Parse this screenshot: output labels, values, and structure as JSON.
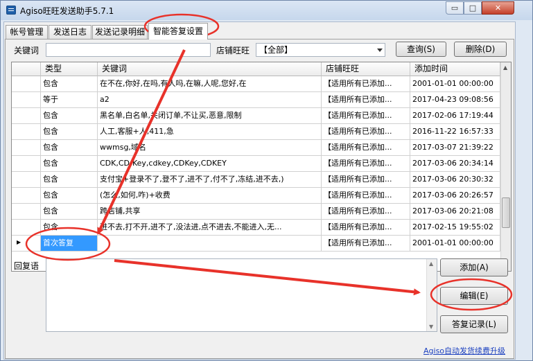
{
  "window": {
    "title": "Agiso旺旺发送助手5.7.1",
    "controls": {
      "minimize": "▭",
      "maximize": "□",
      "close": "✕"
    }
  },
  "tabs": [
    {
      "label": "帐号管理"
    },
    {
      "label": "发送日志"
    },
    {
      "label": "发送记录明细"
    },
    {
      "label": "智能答复设置"
    }
  ],
  "filter": {
    "keyword_label": "关键词",
    "keyword_value": "",
    "shop_label": "店铺旺旺",
    "shop_selected": "【全部】",
    "query_button": "查询(S)",
    "delete_button": "删除(D)"
  },
  "grid": {
    "columns": [
      "类型",
      "关键词",
      "店铺旺旺",
      "添加时间"
    ],
    "rows": [
      {
        "type": "包含",
        "keyword": "在不在,你好,在吗,有人吗,在嘛,人呢,您好,在",
        "shop": "【适用所有已添加...",
        "time": "2001-01-01 00:00:00"
      },
      {
        "type": "等于",
        "keyword": "a2",
        "shop": "【适用所有已添加...",
        "time": "2017-04-23 09:08:56"
      },
      {
        "type": "包含",
        "keyword": "黑名单,白名单,关闭订单,不让买,恶意,限制",
        "shop": "【适用所有已添加...",
        "time": "2017-02-06 17:19:44"
      },
      {
        "type": "包含",
        "keyword": "人工,客服+人,411,急",
        "shop": "【适用所有已添加...",
        "time": "2016-11-22 16:57:33"
      },
      {
        "type": "包含",
        "keyword": "wwmsg,域名",
        "shop": "【适用所有已添加...",
        "time": "2017-03-07 21:39:22"
      },
      {
        "type": "包含",
        "keyword": "CDK,CD-Key,cdkey,CDKey,CDKEY",
        "shop": "【适用所有已添加...",
        "time": "2017-03-06 20:34:14"
      },
      {
        "type": "包含",
        "keyword": "支付宝+登录不了,登不了,进不了,付不了,冻结,进不去,)",
        "shop": "【适用所有已添加...",
        "time": "2017-03-06 20:30:32"
      },
      {
        "type": "包含",
        "keyword": "(怎么,如何,咋)+收费",
        "shop": "【适用所有已添加...",
        "time": "2017-03-06 20:26:57"
      },
      {
        "type": "包含",
        "keyword": "跨店铺,共享",
        "shop": "【适用所有已添加...",
        "time": "2017-03-06 20:21:08"
      },
      {
        "type": "包含",
        "keyword": "进不去,打不开,进不了,没法进,点不进去,不能进入,无...",
        "shop": "【适用所有已添加...",
        "time": "2017-02-15 19:55:02"
      },
      {
        "type": "首次答复",
        "keyword": "",
        "shop": "【适用所有已添加...",
        "time": "2001-01-01 00:00:00"
      }
    ]
  },
  "reply": {
    "label": "回复语",
    "value": "",
    "add_button": "添加(A)",
    "edit_button": "编辑(E)",
    "history_button": "答复记录(L)"
  },
  "footer": {
    "upgrade_link": "Agiso自动发货续费升级"
  },
  "colors": {
    "annotation": "#e8322a",
    "selection": "#3399ff",
    "link": "#1a3fbf"
  }
}
